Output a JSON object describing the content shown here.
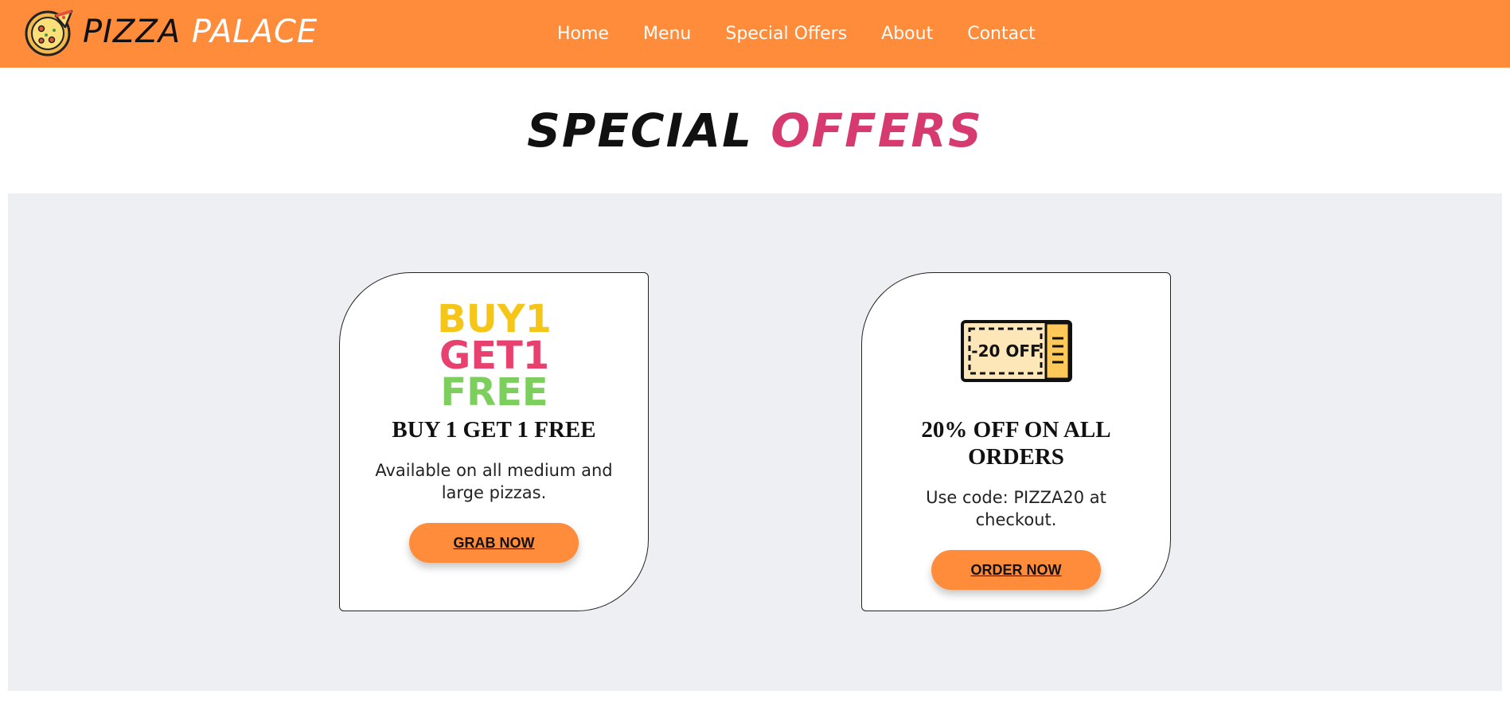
{
  "brand": {
    "word1": "PIZZA",
    "word2": "PALACE",
    "logo_icon": "pizza-icon"
  },
  "nav": {
    "items": [
      {
        "label": "Home"
      },
      {
        "label": "Menu"
      },
      {
        "label": "Special Offers"
      },
      {
        "label": "About"
      },
      {
        "label": "Contact"
      }
    ]
  },
  "page": {
    "title_word1": "SPECIAL",
    "title_word2": "OFFERS"
  },
  "offers": [
    {
      "image_lines": [
        "BUY1",
        "GET1",
        "FREE"
      ],
      "title": "BUY 1 GET 1 FREE",
      "description": "Available on all medium and large pizzas.",
      "button": "GRAB NOW"
    },
    {
      "image_text": "-20 OFF",
      "image_icon": "coupon-icon",
      "title": "20% OFF ON ALL ORDERS",
      "description": "Use code: PIZZA20 at checkout.",
      "button": "ORDER NOW"
    }
  ],
  "colors": {
    "header": "#ff8c3a",
    "accent": "#d63a6e",
    "section_bg": "#eeeff2",
    "button": "#ff8c3a"
  }
}
